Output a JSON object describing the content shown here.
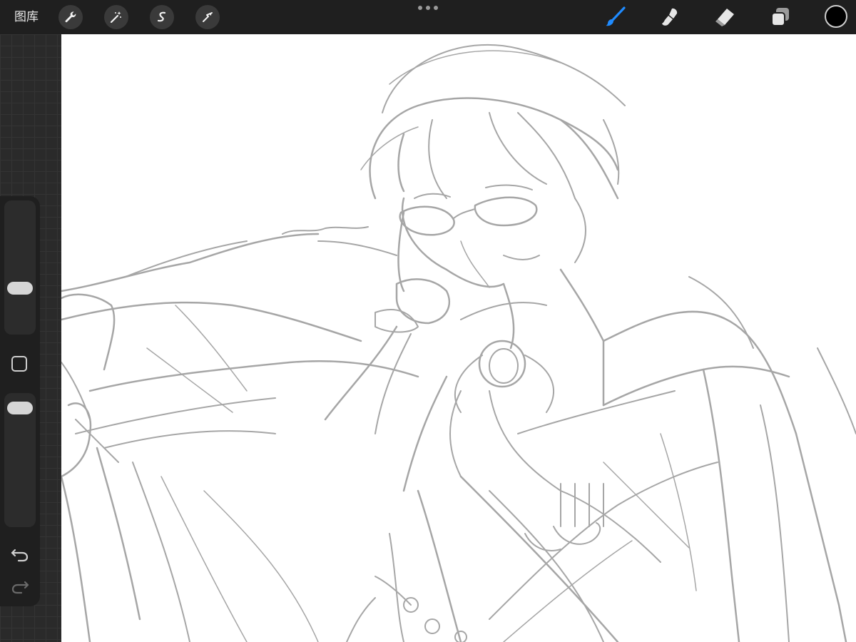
{
  "toolbar": {
    "gallery_label": "图库",
    "left_tools": [
      "wrench-icon",
      "magic-wand-icon",
      "selection-icon",
      "transform-arrow-icon"
    ],
    "right_tools": [
      "brush-icon",
      "smudge-icon",
      "eraser-icon",
      "layers-icon"
    ],
    "active_tool": "brush",
    "active_color": "#0a84ff",
    "current_color": "#000000"
  },
  "sidebar": {
    "brush_size_level": 0.32,
    "brush_opacity_level": 0.95,
    "tools": [
      "size-slider",
      "modify-button",
      "opacity-slider",
      "undo-icon",
      "redo-icon"
    ]
  },
  "canvas": {
    "background": "#ffffff",
    "sketch_color": "#a6a6a6"
  }
}
